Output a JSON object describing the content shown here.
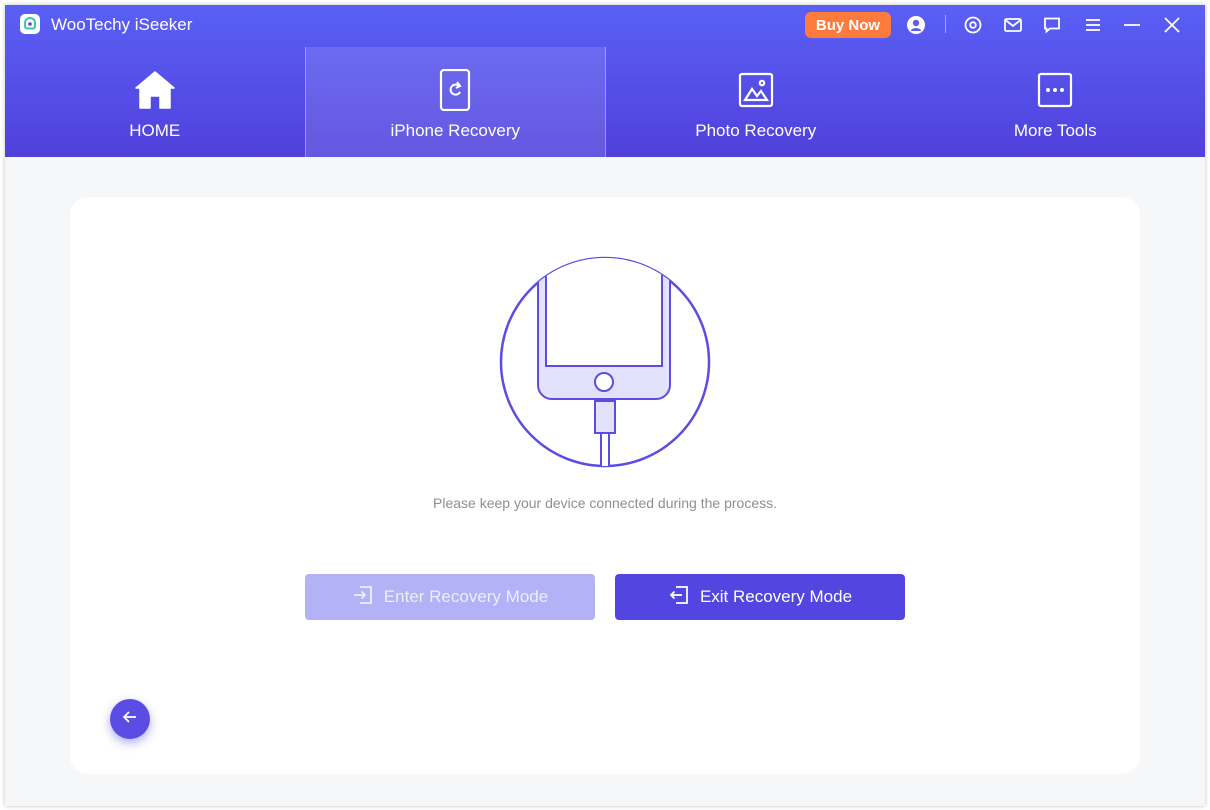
{
  "app": {
    "title": "WooTechy iSeeker",
    "buy_now_label": "Buy Now",
    "titlebar_icons": [
      "user-icon",
      "settings-icon",
      "mail-icon",
      "feedback-icon",
      "menu-icon",
      "minimize-icon",
      "close-icon"
    ]
  },
  "nav": {
    "tabs": [
      {
        "label": "HOME",
        "icon": "home-icon",
        "active": false
      },
      {
        "label": "iPhone Recovery",
        "icon": "iphone-recovery-icon",
        "active": true
      },
      {
        "label": "Photo Recovery",
        "icon": "photo-icon",
        "active": false
      },
      {
        "label": "More Tools",
        "icon": "more-icon",
        "active": false
      }
    ]
  },
  "main": {
    "message": "Please keep your device connected during the process.",
    "enter_button": "Enter Recovery Mode",
    "exit_button": "Exit Recovery Mode"
  },
  "colors": {
    "header_top": "#5a60f5",
    "header_bottom": "#5040dc",
    "accent": "#5346e0",
    "accent_disabled": "#b3b2f7",
    "buy_now": "#ff7a3d"
  }
}
